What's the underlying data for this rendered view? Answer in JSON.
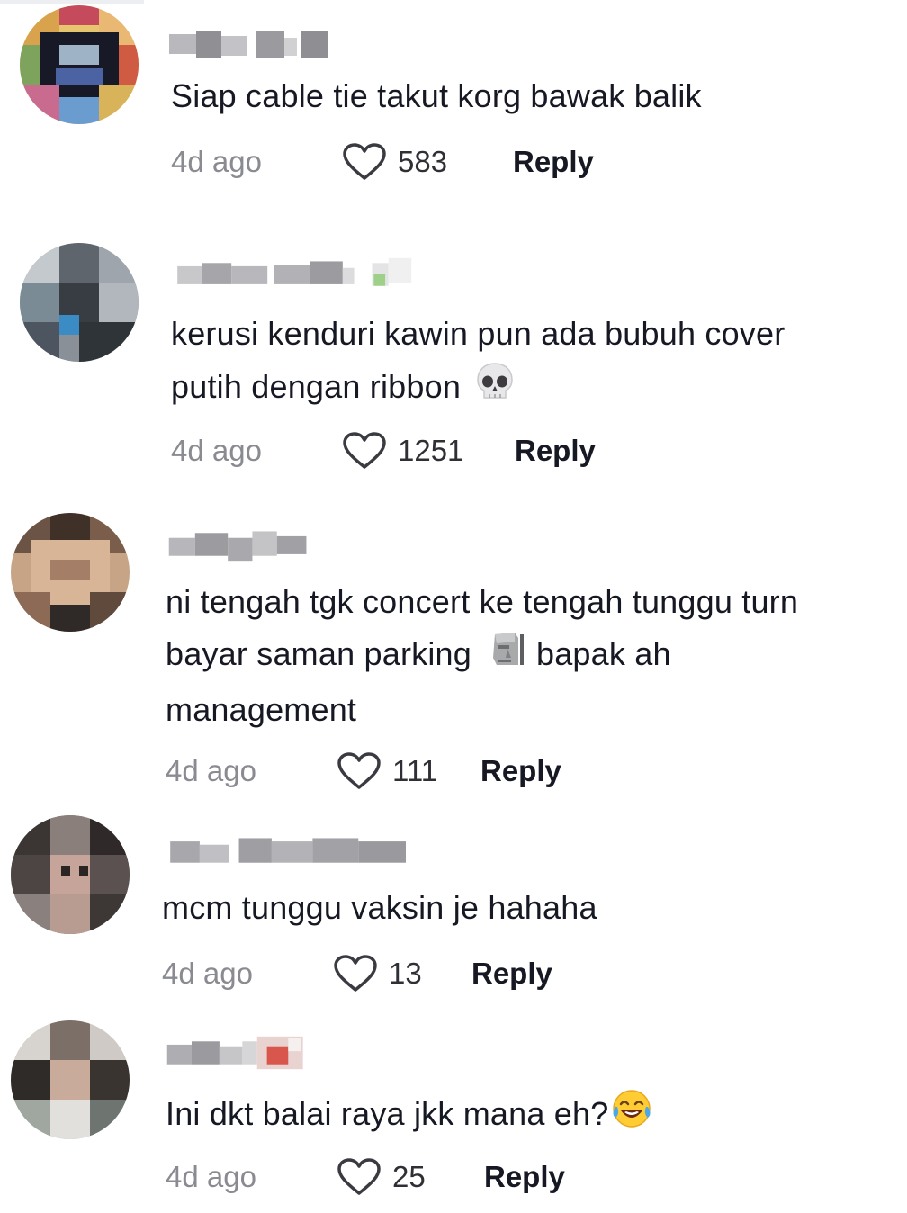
{
  "comments": [
    {
      "text_lines": [
        "Siap cable tie takut korg bawak balik"
      ],
      "time": "4d ago",
      "likes": "583",
      "reply_label": "Reply"
    },
    {
      "text_lines": [
        "kerusi kenduri kawin pun ada bubuh cover",
        "putih dengan ribbon"
      ],
      "emoji": "skull-emoji",
      "time": "4d ago",
      "likes": "1251",
      "reply_label": "Reply"
    },
    {
      "text_lines": [
        "ni tengah tgk concert ke tengah tunggu turn",
        "bayar saman parking",
        "bapak ah",
        "management"
      ],
      "emoji": "moai-emoji",
      "time": "4d ago",
      "likes": "111",
      "reply_label": "Reply"
    },
    {
      "text_lines": [
        "mcm tunggu vaksin je hahaha"
      ],
      "time": "4d ago",
      "likes": "13",
      "reply_label": "Reply"
    },
    {
      "text_lines": [
        "Ini dkt balai raya jkk mana eh?"
      ],
      "emoji": "tears-of-joy-emoji",
      "time": "4d ago",
      "likes": "25",
      "reply_label": "Reply"
    }
  ],
  "colors": {
    "text": "#161823",
    "muted": "#8a8b91",
    "background": "#ffffff"
  }
}
